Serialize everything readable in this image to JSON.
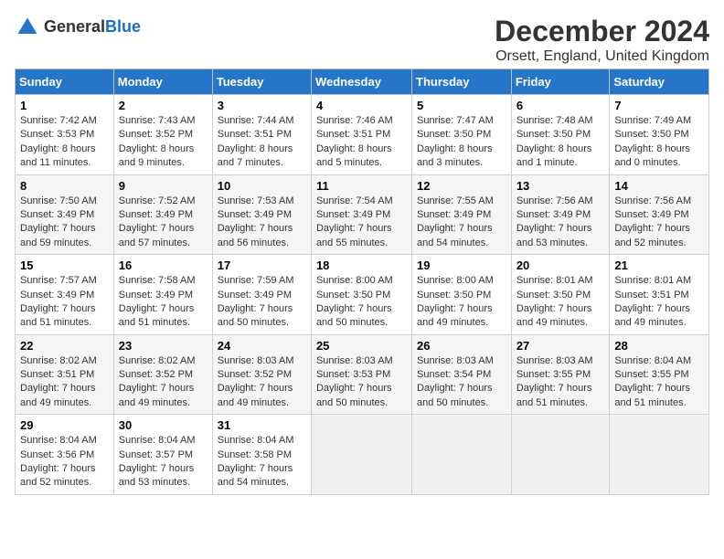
{
  "header": {
    "logo_line1": "General",
    "logo_line2": "Blue",
    "title": "December 2024",
    "subtitle": "Orsett, England, United Kingdom"
  },
  "columns": [
    "Sunday",
    "Monday",
    "Tuesday",
    "Wednesday",
    "Thursday",
    "Friday",
    "Saturday"
  ],
  "weeks": [
    [
      {
        "day": "1",
        "sunrise": "Sunrise: 7:42 AM",
        "sunset": "Sunset: 3:53 PM",
        "daylight": "Daylight: 8 hours and 11 minutes."
      },
      {
        "day": "2",
        "sunrise": "Sunrise: 7:43 AM",
        "sunset": "Sunset: 3:52 PM",
        "daylight": "Daylight: 8 hours and 9 minutes."
      },
      {
        "day": "3",
        "sunrise": "Sunrise: 7:44 AM",
        "sunset": "Sunset: 3:51 PM",
        "daylight": "Daylight: 8 hours and 7 minutes."
      },
      {
        "day": "4",
        "sunrise": "Sunrise: 7:46 AM",
        "sunset": "Sunset: 3:51 PM",
        "daylight": "Daylight: 8 hours and 5 minutes."
      },
      {
        "day": "5",
        "sunrise": "Sunrise: 7:47 AM",
        "sunset": "Sunset: 3:50 PM",
        "daylight": "Daylight: 8 hours and 3 minutes."
      },
      {
        "day": "6",
        "sunrise": "Sunrise: 7:48 AM",
        "sunset": "Sunset: 3:50 PM",
        "daylight": "Daylight: 8 hours and 1 minute."
      },
      {
        "day": "7",
        "sunrise": "Sunrise: 7:49 AM",
        "sunset": "Sunset: 3:50 PM",
        "daylight": "Daylight: 8 hours and 0 minutes."
      }
    ],
    [
      {
        "day": "8",
        "sunrise": "Sunrise: 7:50 AM",
        "sunset": "Sunset: 3:49 PM",
        "daylight": "Daylight: 7 hours and 59 minutes."
      },
      {
        "day": "9",
        "sunrise": "Sunrise: 7:52 AM",
        "sunset": "Sunset: 3:49 PM",
        "daylight": "Daylight: 7 hours and 57 minutes."
      },
      {
        "day": "10",
        "sunrise": "Sunrise: 7:53 AM",
        "sunset": "Sunset: 3:49 PM",
        "daylight": "Daylight: 7 hours and 56 minutes."
      },
      {
        "day": "11",
        "sunrise": "Sunrise: 7:54 AM",
        "sunset": "Sunset: 3:49 PM",
        "daylight": "Daylight: 7 hours and 55 minutes."
      },
      {
        "day": "12",
        "sunrise": "Sunrise: 7:55 AM",
        "sunset": "Sunset: 3:49 PM",
        "daylight": "Daylight: 7 hours and 54 minutes."
      },
      {
        "day": "13",
        "sunrise": "Sunrise: 7:56 AM",
        "sunset": "Sunset: 3:49 PM",
        "daylight": "Daylight: 7 hours and 53 minutes."
      },
      {
        "day": "14",
        "sunrise": "Sunrise: 7:56 AM",
        "sunset": "Sunset: 3:49 PM",
        "daylight": "Daylight: 7 hours and 52 minutes."
      }
    ],
    [
      {
        "day": "15",
        "sunrise": "Sunrise: 7:57 AM",
        "sunset": "Sunset: 3:49 PM",
        "daylight": "Daylight: 7 hours and 51 minutes."
      },
      {
        "day": "16",
        "sunrise": "Sunrise: 7:58 AM",
        "sunset": "Sunset: 3:49 PM",
        "daylight": "Daylight: 7 hours and 51 minutes."
      },
      {
        "day": "17",
        "sunrise": "Sunrise: 7:59 AM",
        "sunset": "Sunset: 3:49 PM",
        "daylight": "Daylight: 7 hours and 50 minutes."
      },
      {
        "day": "18",
        "sunrise": "Sunrise: 8:00 AM",
        "sunset": "Sunset: 3:50 PM",
        "daylight": "Daylight: 7 hours and 50 minutes."
      },
      {
        "day": "19",
        "sunrise": "Sunrise: 8:00 AM",
        "sunset": "Sunset: 3:50 PM",
        "daylight": "Daylight: 7 hours and 49 minutes."
      },
      {
        "day": "20",
        "sunrise": "Sunrise: 8:01 AM",
        "sunset": "Sunset: 3:50 PM",
        "daylight": "Daylight: 7 hours and 49 minutes."
      },
      {
        "day": "21",
        "sunrise": "Sunrise: 8:01 AM",
        "sunset": "Sunset: 3:51 PM",
        "daylight": "Daylight: 7 hours and 49 minutes."
      }
    ],
    [
      {
        "day": "22",
        "sunrise": "Sunrise: 8:02 AM",
        "sunset": "Sunset: 3:51 PM",
        "daylight": "Daylight: 7 hours and 49 minutes."
      },
      {
        "day": "23",
        "sunrise": "Sunrise: 8:02 AM",
        "sunset": "Sunset: 3:52 PM",
        "daylight": "Daylight: 7 hours and 49 minutes."
      },
      {
        "day": "24",
        "sunrise": "Sunrise: 8:03 AM",
        "sunset": "Sunset: 3:52 PM",
        "daylight": "Daylight: 7 hours and 49 minutes."
      },
      {
        "day": "25",
        "sunrise": "Sunrise: 8:03 AM",
        "sunset": "Sunset: 3:53 PM",
        "daylight": "Daylight: 7 hours and 50 minutes."
      },
      {
        "day": "26",
        "sunrise": "Sunrise: 8:03 AM",
        "sunset": "Sunset: 3:54 PM",
        "daylight": "Daylight: 7 hours and 50 minutes."
      },
      {
        "day": "27",
        "sunrise": "Sunrise: 8:03 AM",
        "sunset": "Sunset: 3:55 PM",
        "daylight": "Daylight: 7 hours and 51 minutes."
      },
      {
        "day": "28",
        "sunrise": "Sunrise: 8:04 AM",
        "sunset": "Sunset: 3:55 PM",
        "daylight": "Daylight: 7 hours and 51 minutes."
      }
    ],
    [
      {
        "day": "29",
        "sunrise": "Sunrise: 8:04 AM",
        "sunset": "Sunset: 3:56 PM",
        "daylight": "Daylight: 7 hours and 52 minutes."
      },
      {
        "day": "30",
        "sunrise": "Sunrise: 8:04 AM",
        "sunset": "Sunset: 3:57 PM",
        "daylight": "Daylight: 7 hours and 53 minutes."
      },
      {
        "day": "31",
        "sunrise": "Sunrise: 8:04 AM",
        "sunset": "Sunset: 3:58 PM",
        "daylight": "Daylight: 7 hours and 54 minutes."
      },
      null,
      null,
      null,
      null
    ]
  ]
}
